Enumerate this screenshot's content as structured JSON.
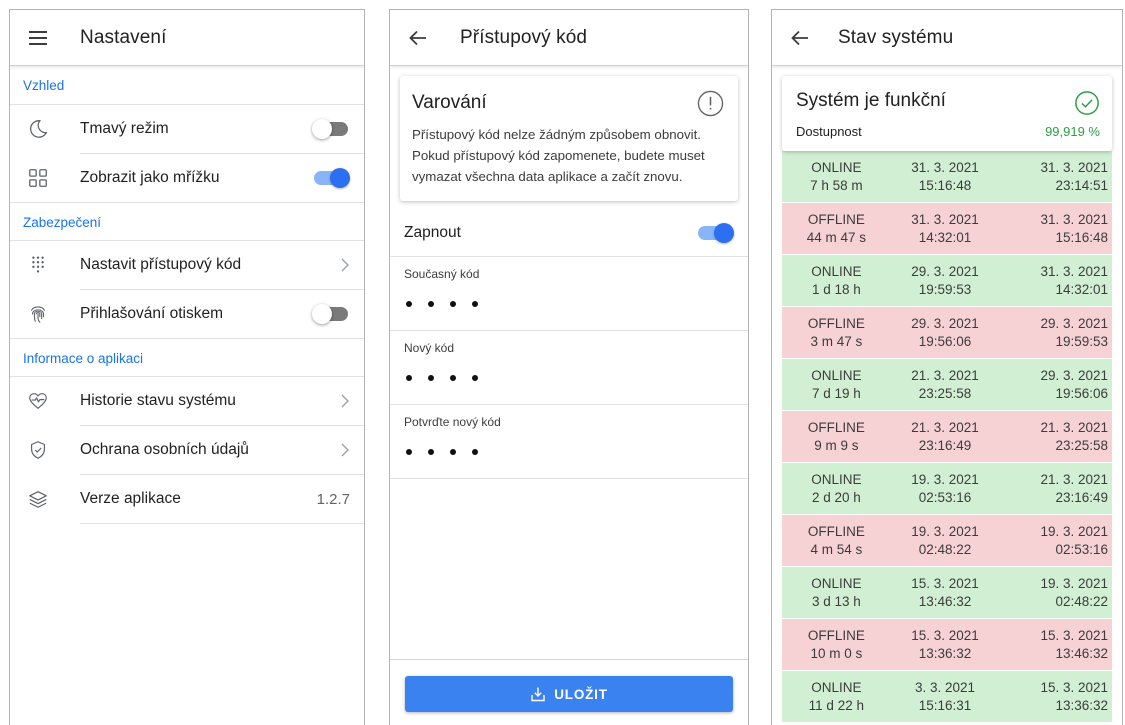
{
  "settings": {
    "title": "Nastavení",
    "sections": {
      "appearance": "Vzhled",
      "security": "Zabezpečení",
      "about": "Informace o aplikaci"
    },
    "items": {
      "dark_mode": "Tmavý režim",
      "grid_view": "Zobrazit jako mřížku",
      "set_passcode": "Nastavit přístupový kód",
      "fingerprint": "Přihlašování otiskem",
      "status_history": "Historie stavu systému",
      "privacy": "Ochrana osobních údajů",
      "version": "Verze aplikace",
      "version_value": "1.2.7"
    },
    "toggles": {
      "dark_mode": false,
      "grid_view": true,
      "fingerprint": false
    }
  },
  "passcode": {
    "title": "Přístupový kód",
    "warning_title": "Varování",
    "warning_text": "Přístupový kód nelze žádným způsobem obnovit. Pokud přístupový kód zapomenete, budete muset vymazat všechna data aplikace a začít znovu.",
    "enable_label": "Zapnout",
    "enable_on": true,
    "fields": {
      "current": "Současný kód",
      "new": "Nový kód",
      "confirm": "Potvrďte nový kód"
    },
    "save_label": "ULOŽIT"
  },
  "status": {
    "title": "Stav systému",
    "card_title": "Systém je funkční",
    "availability_label": "Dostupnost",
    "availability_value": "99,919 %",
    "history": [
      {
        "state": "ONLINE",
        "duration": "7 h 58 m",
        "from_date": "31. 3. 2021",
        "from_time": "15:16:48",
        "to_date": "31. 3. 2021",
        "to_time": "23:14:51"
      },
      {
        "state": "OFFLINE",
        "duration": "44 m 47 s",
        "from_date": "31. 3. 2021",
        "from_time": "14:32:01",
        "to_date": "31. 3. 2021",
        "to_time": "15:16:48"
      },
      {
        "state": "ONLINE",
        "duration": "1 d 18 h",
        "from_date": "29. 3. 2021",
        "from_time": "19:59:53",
        "to_date": "31. 3. 2021",
        "to_time": "14:32:01"
      },
      {
        "state": "OFFLINE",
        "duration": "3 m 47 s",
        "from_date": "29. 3. 2021",
        "from_time": "19:56:06",
        "to_date": "29. 3. 2021",
        "to_time": "19:59:53"
      },
      {
        "state": "ONLINE",
        "duration": "7 d 19 h",
        "from_date": "21. 3. 2021",
        "from_time": "23:25:58",
        "to_date": "29. 3. 2021",
        "to_time": "19:56:06"
      },
      {
        "state": "OFFLINE",
        "duration": "9 m 9 s",
        "from_date": "21. 3. 2021",
        "from_time": "23:16:49",
        "to_date": "21. 3. 2021",
        "to_time": "23:25:58"
      },
      {
        "state": "ONLINE",
        "duration": "2 d 20 h",
        "from_date": "19. 3. 2021",
        "from_time": "02:53:16",
        "to_date": "21. 3. 2021",
        "to_time": "23:16:49"
      },
      {
        "state": "OFFLINE",
        "duration": "4 m 54 s",
        "from_date": "19. 3. 2021",
        "from_time": "02:48:22",
        "to_date": "19. 3. 2021",
        "to_time": "02:53:16"
      },
      {
        "state": "ONLINE",
        "duration": "3 d 13 h",
        "from_date": "15. 3. 2021",
        "from_time": "13:46:32",
        "to_date": "19. 3. 2021",
        "to_time": "02:48:22"
      },
      {
        "state": "OFFLINE",
        "duration": "10 m 0 s",
        "from_date": "15. 3. 2021",
        "from_time": "13:36:32",
        "to_date": "15. 3. 2021",
        "to_time": "13:46:32"
      },
      {
        "state": "ONLINE",
        "duration": "11 d 22 h",
        "from_date": "3. 3. 2021",
        "from_time": "15:16:31",
        "to_date": "15. 3. 2021",
        "to_time": "13:36:32"
      }
    ]
  },
  "colors": {
    "accent": "#1a73e8",
    "switch_on": "#2c6ff0",
    "online_row": "#d1efd3",
    "offline_row": "#f6d2d4",
    "ok_green": "#2e9e44",
    "button": "#3a82f0"
  },
  "icons": {
    "menu": "menu-icon",
    "back": "arrow-back-icon",
    "dark_mode": "moon-icon",
    "grid": "grid-icon",
    "passcode": "keypad-icon",
    "fingerprint": "fingerprint-icon",
    "history": "heart-pulse-icon",
    "privacy": "shield-check-icon",
    "version": "layers-icon",
    "warning": "exclamation-circle-icon",
    "ok": "check-circle-icon",
    "save": "download-icon"
  }
}
